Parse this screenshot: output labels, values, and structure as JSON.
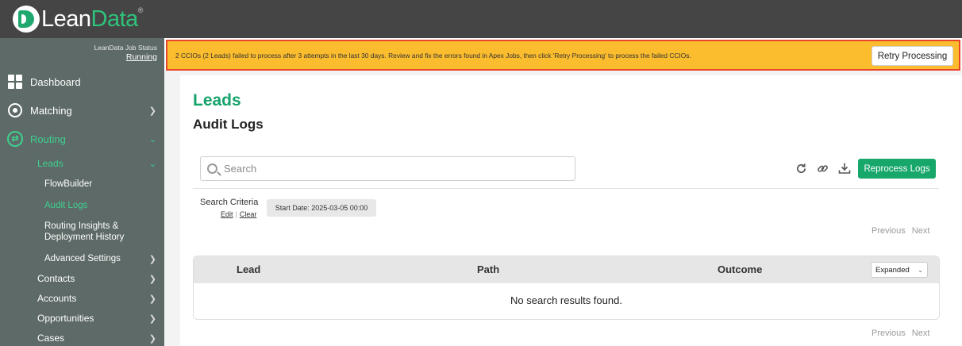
{
  "app": {
    "logo_lean": "Lean",
    "logo_data": "Data",
    "logo_tm": "®"
  },
  "sidebar": {
    "job_status_title": "LeanData Job Status",
    "job_status_value": "Running",
    "items": [
      {
        "label": "Dashboard"
      },
      {
        "label": "Matching"
      },
      {
        "label": "Routing"
      },
      {
        "label": "Leads"
      },
      {
        "label": "FlowBuilder"
      },
      {
        "label": "Audit Logs"
      },
      {
        "label": "Routing Insights &"
      },
      {
        "label": "Deployment History"
      },
      {
        "label": "Advanced Settings"
      },
      {
        "label": "Contacts"
      },
      {
        "label": "Accounts"
      },
      {
        "label": "Opportunities"
      },
      {
        "label": "Cases"
      }
    ]
  },
  "banner": {
    "message": "2 CCIOs (2 Leads) failed to process after 3 attempts in the last 30 days. Review and fix the errors found in Apex Jobs, then click 'Retry Processing' to process the failed CCIOs.",
    "button": "Retry Processing",
    "background": "#fbbc2e",
    "border": "#e8452a"
  },
  "page": {
    "title": "Leads",
    "subtitle": "Audit Logs",
    "accent": "#16a36a"
  },
  "search": {
    "placeholder": "Search",
    "value": ""
  },
  "toolbar": {
    "refresh_icon": "refresh-icon",
    "link_icon": "link-icon",
    "download_icon": "download-icon",
    "reprocess_label": "Reprocess Logs"
  },
  "criteria": {
    "label": "Search Criteria",
    "edit": "Edit",
    "clear": "Clear",
    "start_date": "Start Date: 2025-03-05 00:00"
  },
  "pager": {
    "previous": "Previous",
    "next": "Next"
  },
  "table": {
    "columns": [
      "Lead",
      "Path",
      "Outcome"
    ],
    "view_select": "Expanded",
    "empty": "No search results found."
  }
}
